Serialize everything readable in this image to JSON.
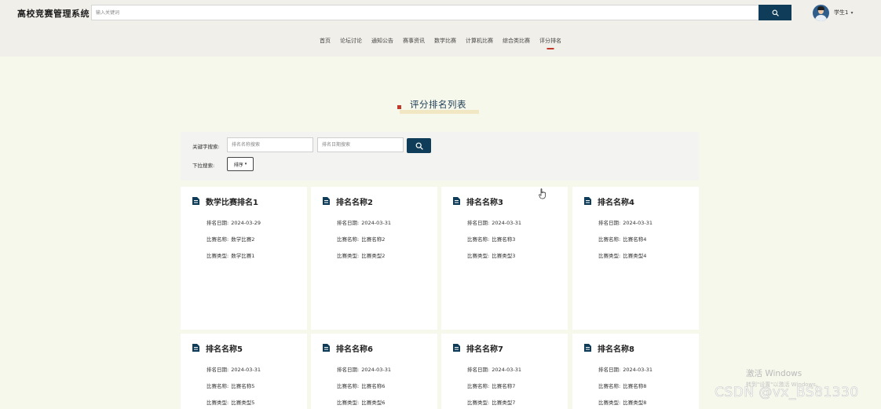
{
  "header": {
    "site_title": "高校竞赛管理系统",
    "search_placeholder": "输入关键词",
    "user_name": "学生1"
  },
  "nav": {
    "items": [
      "首页",
      "论坛讨论",
      "通知公告",
      "赛事资讯",
      "数学比赛",
      "计算机比赛",
      "综合类比赛",
      "评分排名"
    ],
    "active": "评分排名"
  },
  "section": {
    "title": "评分排名列表"
  },
  "filter": {
    "keyword_label": "关键字搜索:",
    "name_placeholder": "排名名称搜索",
    "date_placeholder": "排名日期搜索",
    "dropdown_label": "下拉搜索:",
    "sort_label": "排序"
  },
  "cards": [
    {
      "title": "数学比赛排名1",
      "date_label": "排名日期:",
      "date": "2024-03-29",
      "comp_name_label": "比赛名称:",
      "comp_name": "数学比赛2",
      "comp_type_label": "比赛类型:",
      "comp_type": "数学比赛1"
    },
    {
      "title": "排名名称2",
      "date_label": "排名日期:",
      "date": "2024-03-31",
      "comp_name_label": "比赛名称:",
      "comp_name": "比赛名称2",
      "comp_type_label": "比赛类型:",
      "comp_type": "比赛类型2"
    },
    {
      "title": "排名名称3",
      "date_label": "排名日期:",
      "date": "2024-03-31",
      "comp_name_label": "比赛名称:",
      "comp_name": "比赛名称3",
      "comp_type_label": "比赛类型:",
      "comp_type": "比赛类型3"
    },
    {
      "title": "排名名称4",
      "date_label": "排名日期:",
      "date": "2024-03-31",
      "comp_name_label": "比赛名称:",
      "comp_name": "比赛名称4",
      "comp_type_label": "比赛类型:",
      "comp_type": "比赛类型4"
    },
    {
      "title": "排名名称5",
      "date_label": "排名日期:",
      "date": "2024-03-31",
      "comp_name_label": "比赛名称:",
      "comp_name": "比赛名称5",
      "comp_type_label": "比赛类型:",
      "comp_type": "比赛类型5"
    },
    {
      "title": "排名名称6",
      "date_label": "排名日期:",
      "date": "2024-03-31",
      "comp_name_label": "比赛名称:",
      "comp_name": "比赛名称6",
      "comp_type_label": "比赛类型:",
      "comp_type": "比赛类型6"
    },
    {
      "title": "排名名称7",
      "date_label": "排名日期:",
      "date": "2024-03-31",
      "comp_name_label": "比赛名称:",
      "comp_name": "比赛名称7",
      "comp_type_label": "比赛类型:",
      "comp_type": "比赛类型7"
    },
    {
      "title": "排名名称8",
      "date_label": "排名日期:",
      "date": "2024-03-31",
      "comp_name_label": "比赛名称:",
      "comp_name": "比赛名称8",
      "comp_type_label": "比赛类型:",
      "comp_type": "比赛类型8"
    }
  ],
  "overlay": {
    "windows_activate": "激活 Windows",
    "windows_activate_sub": "转到\"设置\"以激活 Windows。",
    "csdn_watermark": "CSDN @vx_BS81330"
  },
  "colors": {
    "primary": "#0f3d59",
    "accent": "#c0392b",
    "page_bg": "#f7f8ec",
    "header_bg": "#f1efe9"
  },
  "icons": {
    "search": "search-icon",
    "card": "document-icon",
    "caret": "chevron-down-icon"
  }
}
